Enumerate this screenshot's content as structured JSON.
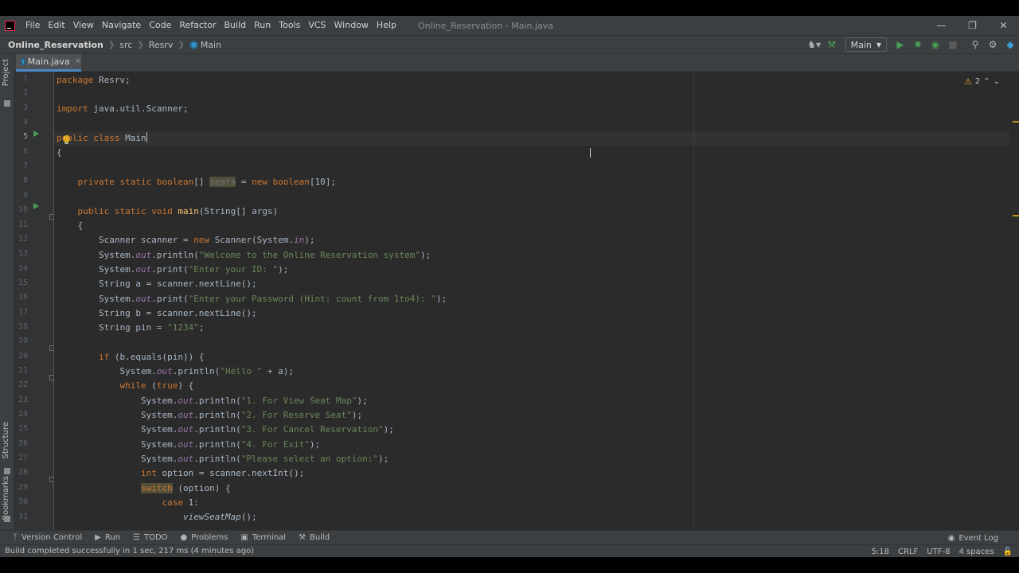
{
  "menu": {
    "items": [
      "File",
      "Edit",
      "View",
      "Navigate",
      "Code",
      "Refactor",
      "Build",
      "Run",
      "Tools",
      "VCS",
      "Window",
      "Help"
    ],
    "window_title": "Online_Reservation - Main.java"
  },
  "navbar": {
    "project": "Online_Reservation",
    "crumbs": [
      "src",
      "Resrv",
      "Main"
    ],
    "run_config": "Main"
  },
  "tab": {
    "label": "Main.java"
  },
  "sidebars": {
    "project": "Project",
    "structure": "Structure",
    "bookmarks": "Bookmarks"
  },
  "editor": {
    "warnings_count": "2",
    "line_numbers": [
      "1",
      "2",
      "3",
      "4",
      "5",
      "6",
      "7",
      "8",
      "9",
      "10",
      "11",
      "12",
      "13",
      "14",
      "15",
      "16",
      "17",
      "18",
      "19",
      "20",
      "21",
      "22",
      "23",
      "24",
      "25",
      "26",
      "27",
      "28",
      "29",
      "30",
      "31"
    ],
    "caret_line": 5
  },
  "tool_windows": {
    "version_control": "Version Control",
    "run": "Run",
    "todo": "TODO",
    "problems": "Problems",
    "terminal": "Terminal",
    "build": "Build",
    "event_log": "Event Log"
  },
  "status": {
    "message": "Build completed successfully in 1 sec, 217 ms (4 minutes ago)",
    "position": "5:18",
    "line_sep": "CRLF",
    "encoding": "UTF-8",
    "indent": "4 spaces"
  },
  "colors": {
    "editor_bg": "#2b2b2b",
    "keyword": "#cc7832",
    "string": "#6a8759",
    "field": "#9876aa",
    "method": "#ffc66d"
  }
}
